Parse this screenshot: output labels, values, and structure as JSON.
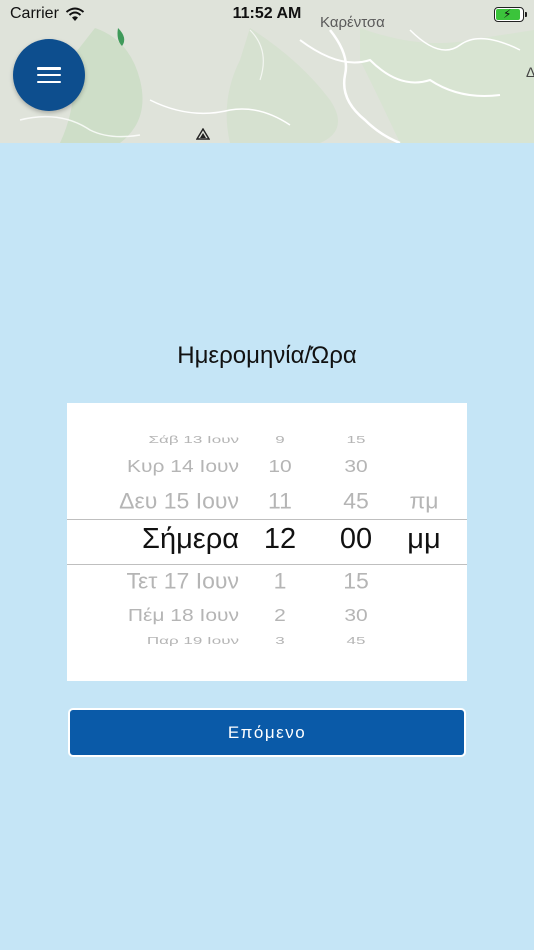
{
  "status_bar": {
    "carrier": "Carrier",
    "time": "11:52 AM"
  },
  "map": {
    "place_label": "Καρέντσα",
    "right_edge_label": "Δ"
  },
  "menu": {
    "icon": "hamburger-menu-icon"
  },
  "title": "Ημερομηνία/Ώρα",
  "picker": {
    "dates": [
      "Σάβ 13 Ιουν",
      "Κυρ 14 Ιουν",
      "Δευ 15 Ιουν",
      "Σήμερα",
      "Τετ 17 Ιουν",
      "Πέμ 18 Ιουν",
      "Παρ 19 Ιουν"
    ],
    "hours": [
      "9",
      "10",
      "11",
      "12",
      "1",
      "2",
      "3"
    ],
    "minutes": [
      "15",
      "30",
      "45",
      "00",
      "15",
      "30",
      "45"
    ],
    "ampm": [
      "πμ",
      "μμ"
    ],
    "selected": {
      "date": "Σήμερα",
      "hour": "12",
      "minute": "00",
      "ampm": "μμ"
    }
  },
  "next_button": {
    "label": "Επόμενο"
  },
  "colors": {
    "background": "#c5e5f6",
    "accent": "#0a5aa8",
    "menu_button": "#0d4e8e"
  }
}
